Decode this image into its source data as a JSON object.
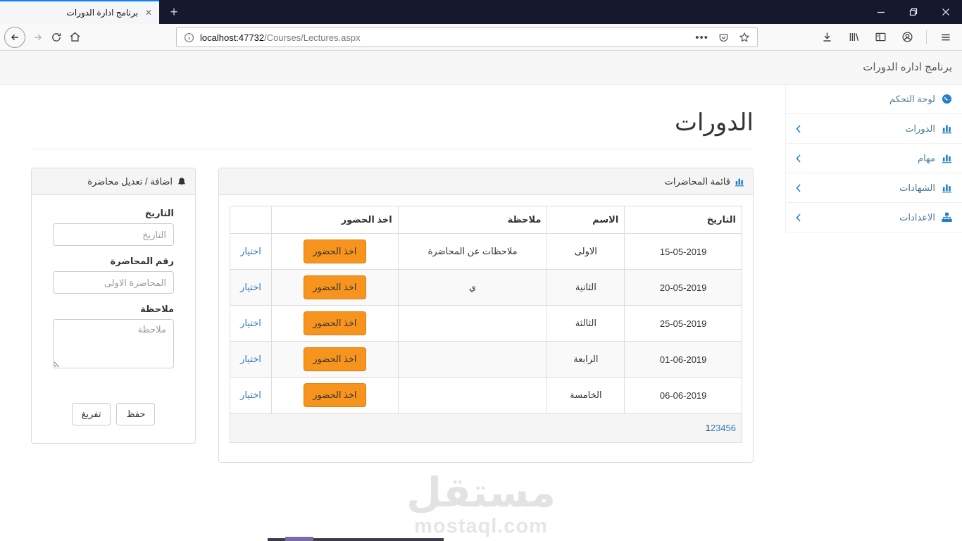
{
  "colors": {
    "accent_orange": "#F7941E",
    "link_blue": "#337AB7",
    "icon_blue": "#1E7FC9",
    "tab_bar": "#16182D",
    "firefox_accent": "#0A84FF"
  },
  "browser": {
    "tab_title": "برنامج ادارة الدورات",
    "new_tab_button": "+",
    "url": {
      "host": "localhost:47732",
      "path": "/Courses/Lectures.aspx"
    },
    "toolbar_icon_names": [
      "back",
      "forward",
      "refresh",
      "home"
    ],
    "urlbar_icon_names": [
      "info",
      "page-actions",
      "pocket",
      "bookmark-star"
    ],
    "right_icon_names": [
      "download",
      "library",
      "sidebar",
      "account",
      "menu"
    ],
    "window_control_names": [
      "minimize",
      "restore",
      "close"
    ]
  },
  "app": {
    "brand": "برنامج اداره الدورات",
    "sidebar": {
      "items": [
        {
          "label": "لوحة التحكم",
          "icon": "dashboard-icon"
        },
        {
          "label": "الدورات",
          "icon": "bar-chart-icon"
        },
        {
          "label": "مهام",
          "icon": "bar-chart-icon"
        },
        {
          "label": "الشهادات",
          "icon": "bar-chart-icon"
        },
        {
          "label": "الاعدادات",
          "icon": "sitemap-icon"
        }
      ]
    },
    "page_title": "الدورات",
    "list_panel": {
      "title": "قائمة المحاضرات",
      "headers": [
        "التاريخ",
        "الاسم",
        "ملاحظة",
        "اخذ الحضور",
        ""
      ],
      "rows": [
        {
          "date": "15-05-2019",
          "name": "الاولى",
          "note": "ملاحظات عن المحاضرة"
        },
        {
          "date": "20-05-2019",
          "name": "الثانية",
          "note": "ي"
        },
        {
          "date": "25-05-2019",
          "name": "الثالثة",
          "note": ""
        },
        {
          "date": "01-06-2019",
          "name": "الرابعة",
          "note": ""
        },
        {
          "date": "06-06-2019",
          "name": "الخامسة",
          "note": ""
        }
      ],
      "attendance_button": "اخذ الحضور",
      "choose_link": "اختيار",
      "pager": {
        "current": "1",
        "links": [
          "2",
          "3",
          "4",
          "5",
          "6"
        ]
      }
    },
    "form_panel": {
      "title": "اضافة / تعديل محاضرة",
      "fields": {
        "date": {
          "label": "التاريخ",
          "placeholder": "التاريخ"
        },
        "lecture_number": {
          "label": "رقم المحاضرة",
          "placeholder": "المحاضرة الاولى"
        },
        "note": {
          "label": "ملاحظة",
          "placeholder": "ملاحظة"
        }
      },
      "buttons": {
        "save": "حفظ",
        "clear": "تفريغ"
      }
    }
  },
  "watermark": {
    "arabic": "مستقل",
    "latin": "mostaql.com"
  }
}
